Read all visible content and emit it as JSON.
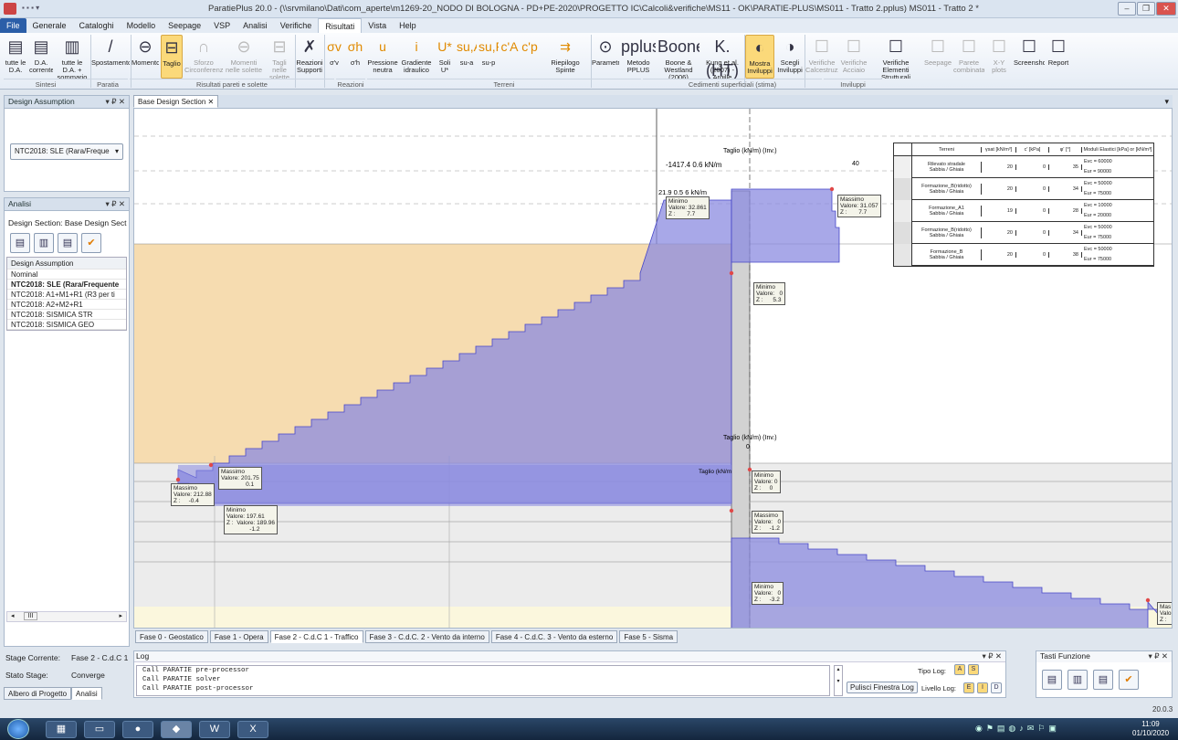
{
  "window": {
    "title": "ParatiePlus 20.0 - (\\\\srvmilano\\Dati\\com_aperte\\m1269-20_NODO DI BOLOGNA - PD+PE-2020\\PROGETTO IC\\Calcoli&verifiche\\MS11 - OK\\PARATIE-PLUS\\MS011 - Tratto 2.pplus) MS011 - Tratto 2 *",
    "min": "–",
    "max": "❐",
    "close": "✕"
  },
  "menu": [
    "File",
    "Generale",
    "Cataloghi",
    "Modello",
    "Seepage",
    "VSP",
    "Analisi",
    "Verifiche",
    "Risultati",
    "Vista",
    "Help"
  ],
  "ribbon": {
    "buttons": [
      {
        "label": "tutte le D.A.",
        "icon": "▤"
      },
      {
        "label": "D.A. corrente",
        "icon": "▤"
      },
      {
        "label": "tutte le D.A. + sommario",
        "icon": "▥"
      },
      {
        "label": "Spostamento",
        "icon": "/"
      },
      {
        "label": "Momento",
        "icon": "⊖"
      },
      {
        "label": "Taglio",
        "icon": "⊟"
      },
      {
        "label": "Sforzo Circonferenziale",
        "icon": "∩"
      },
      {
        "label": "Momenti nelle solette",
        "icon": "⊖"
      },
      {
        "label": "Tagli nelle solette",
        "icon": "⊟"
      },
      {
        "label": "Reazioni Supporti",
        "icon": "✗"
      },
      {
        "label": "σ'v",
        "icon": "σv"
      },
      {
        "label": "σ'h",
        "icon": "σh"
      },
      {
        "label": "Pressione neutra",
        "icon": "u"
      },
      {
        "label": "Gradiente idraulico",
        "icon": "i"
      },
      {
        "label": "Soli U*",
        "icon": "U*"
      },
      {
        "label": "su-a",
        "icon": "su,A"
      },
      {
        "label": "su-p",
        "icon": "su,P"
      },
      {
        "label": "",
        "icon": "c'A"
      },
      {
        "label": "",
        "icon": "c'p"
      },
      {
        "label": "Riepilogo Spinte",
        "icon": "⇉"
      },
      {
        "label": "Parametri",
        "icon": "⊙"
      },
      {
        "label": "Metodo PPLUS",
        "icon": "pplus"
      },
      {
        "label": "Boone & Westland (2006)",
        "icon": "Boone"
      },
      {
        "label": "Kung et al. (2007) - Argille",
        "icon": "K.(HT)"
      },
      {
        "label": "Mostra Inviluppi",
        "icon": "◐"
      },
      {
        "label": "Scegli Inviluppi",
        "icon": "◑"
      },
      {
        "label": "Verifiche Calcestruzzo",
        "icon": "☐"
      },
      {
        "label": "Verifiche Acciaio",
        "icon": "☐"
      },
      {
        "label": "Verifiche Elementi Strutturali",
        "icon": "☐"
      },
      {
        "label": "Seepage",
        "icon": "☐"
      },
      {
        "label": "Parete combinata",
        "icon": "☐"
      },
      {
        "label": "X-Y plots",
        "icon": "☐"
      },
      {
        "label": "Screenshot",
        "icon": "☐"
      },
      {
        "label": "Report",
        "icon": "☐"
      }
    ],
    "groups": [
      "Sintesi",
      "Paratia",
      "Risultati pareti e solette",
      "Reazioni",
      "Terreni",
      "Cedimenti superficiali (stima)",
      "Inviluppi"
    ]
  },
  "left": {
    "design_assumption_title": "Design Assumption",
    "da_select": "NTC2018: SLE (Rara/Freque",
    "analisi_title": "Analisi",
    "design_section": "Design Section:  Base Design Sect",
    "list_header": "Design Assumption",
    "list": [
      "Nominal",
      "NTC2018: SLE (Rara/Frequente",
      "NTC2018: A1+M1+R1 (R3 per ti",
      "NTC2018: A2+M2+R1",
      "NTC2018: SISMICA STR",
      "NTC2018: SISMICA GEO"
    ],
    "stage_corrente_label": "Stage Corrente:",
    "stage_corrente": "Fase 2 - C.d.C 1",
    "stato_label": "Stato Stage:",
    "stato": "Converge",
    "bottom_tabs": [
      "Albero di Progetto",
      "Analisi"
    ],
    "scroll_btn": "III"
  },
  "doc": {
    "tab": "Base Design Section",
    "phases": [
      "Fase 0 - Geostatico",
      "Fase 1 - Opera",
      "Fase 2 - C.d.C 1 - Traffico",
      "Fase 3 - C.d.C. 2 - Vento da interno",
      "Fase 4 - C.d.C. 3 - Vento da esterno",
      "Fase 5 - Sisma"
    ]
  },
  "chart": {
    "top_title": "Taglio (kN/m) (Inv.)",
    "top_value": "-1417.4 0.6 kN/m",
    "top_max": "40",
    "top_value2": "21.9 0.5 6 kN/m",
    "mid_title": "Taglio (kN/m) (Inv.)",
    "mid_zero": "0",
    "mid_title2": "Taglio (kN/m",
    "tips": [
      "Minimo\nValore: 32.861\nZ :       7.7",
      "Massimo\nValore: 31.057\nZ :       7.7",
      "Minimo\nValore:   0\nZ :      5.3",
      "Massimo\nValore: 201.75\n               0.1",
      "Massimo\nValore: 212.88\nZ :     -0.4",
      "Minimo\nValore: 197.61\nZ :  Valore: 189.96\n              -1.2",
      "Minimo\nValore: 0\nZ :     0",
      "Massimo\nValore:   0\nZ :     -1.2",
      "Minimo\nValore:   0\nZ :     -3.2",
      "Mas\nValore\nZ :"
    ]
  },
  "soil_table": {
    "headers": [
      "Terreni",
      "γsat [kN/m³]",
      "c' [kPa]",
      "φ' [°]",
      "Moduli Elastici [kPa] or [kN/m³]"
    ],
    "rows": [
      {
        "name": "Rilevato stradale\nSabbia / Ghiaia",
        "g": "20",
        "c": "0",
        "phi": "35",
        "e1": "Evc = 60000",
        "e2": "Eur = 90000",
        "color": "#f0f0f0"
      },
      {
        "name": "Formazione_B(ridotto)\nSabbia / Ghiaia",
        "g": "20",
        "c": "0",
        "phi": "34",
        "e1": "Evc = 50000",
        "e2": "Eur = 75000",
        "color": "#dedede"
      },
      {
        "name": "Formazione_A1\nSabbia / Ghiaia",
        "g": "19",
        "c": "0",
        "phi": "28",
        "e1": "Evc = 10000",
        "e2": "Eur = 20000",
        "color": "#ececec"
      },
      {
        "name": "Formazione_B(ridotto)\nSabbia / Ghiaia",
        "g": "20",
        "c": "0",
        "phi": "34",
        "e1": "Evc = 50000",
        "e2": "Eur = 75000",
        "color": "#dedede"
      },
      {
        "name": "Formazione_B\nSabbia / Ghiaia",
        "g": "20",
        "c": "0",
        "phi": "38",
        "e1": "Evc = 50000",
        "e2": "Eur = 75000",
        "color": "#e6e6e6"
      }
    ]
  },
  "log": {
    "title": "Log",
    "lines": [
      "Call PARATIE pre-processor",
      "Call PARATIE solver",
      "Call PARATIE post-processor"
    ],
    "clear_btn": "Pulisci Finestra Log",
    "tipo_log": "Tipo Log:",
    "tipo_btns": [
      "A",
      "S"
    ],
    "livello": "Livello Log:",
    "livello_btns": [
      "E",
      "I",
      "D"
    ]
  },
  "tasti": {
    "title": "Tasti Funzione"
  },
  "status": {
    "version": "20.0.3"
  },
  "taskbar": {
    "time": "11:09",
    "date": "01/10/2020"
  },
  "colors": {
    "accent": "#fbd97a",
    "blue_fill": "#8b8be0",
    "sand": "#f6dcb0"
  }
}
